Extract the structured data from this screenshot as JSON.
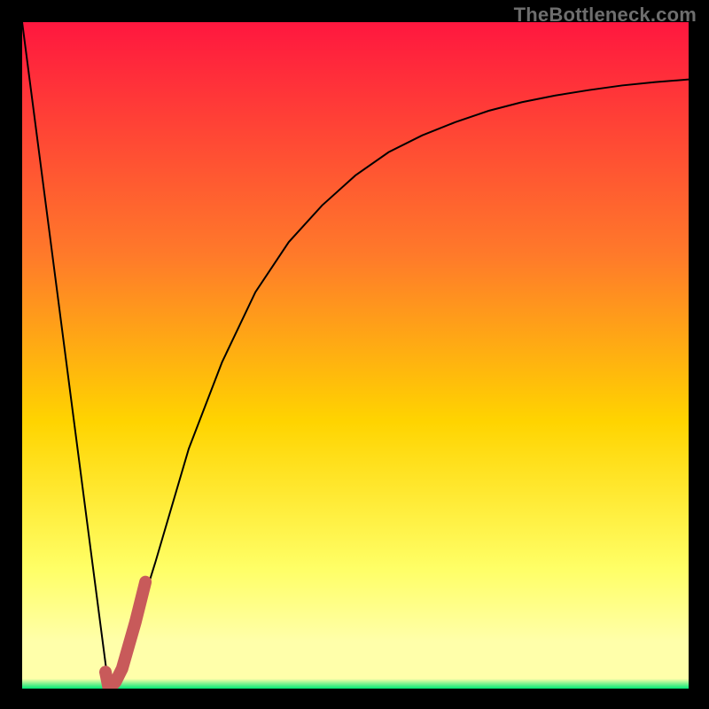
{
  "watermark": "TheBottleneck.com",
  "colors": {
    "frame": "#000000",
    "gradient_top": "#ff173f",
    "gradient_mid_upper": "#ff7a2a",
    "gradient_mid": "#ffd400",
    "gradient_mid_lower": "#ffff66",
    "gradient_pale": "#ffffaa",
    "gradient_bottom": "#00e676",
    "curve": "#000000",
    "marker": "#c85a5a"
  },
  "chart_data": {
    "type": "line",
    "title": "",
    "xlabel": "",
    "ylabel": "",
    "xlim": [
      0,
      100
    ],
    "ylim": [
      0,
      100
    ],
    "grid": false,
    "series": [
      {
        "name": "bottleneck-curve",
        "x": [
          0,
          5,
          10,
          13,
          14,
          15,
          20,
          25,
          30,
          35,
          40,
          45,
          50,
          55,
          60,
          65,
          70,
          75,
          80,
          85,
          90,
          95,
          100
        ],
        "values": [
          100,
          61.5,
          23,
          0,
          1,
          3,
          19,
          36,
          49,
          59.5,
          67,
          72.5,
          77,
          80.5,
          83,
          85,
          86.7,
          88,
          89,
          89.8,
          90.5,
          91,
          91.4
        ]
      }
    ],
    "marker_segment": {
      "name": "highlighted-range",
      "x": [
        12.5,
        13,
        14,
        15,
        17,
        18.5
      ],
      "values": [
        2.5,
        0,
        1,
        3,
        10,
        16
      ]
    }
  }
}
